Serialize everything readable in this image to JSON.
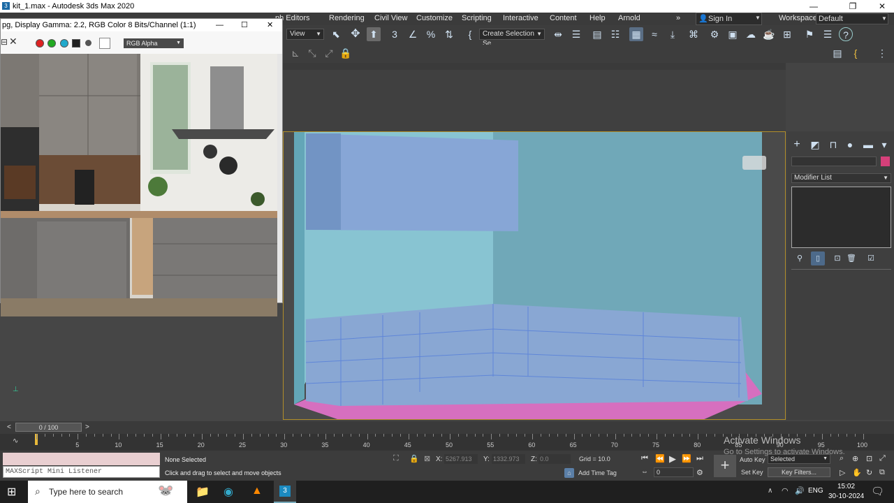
{
  "window": {
    "title": "kit_1.max - Autodesk 3ds Max 2020",
    "controls": {
      "minimize": "—",
      "maximize": "❐",
      "close": "✕"
    }
  },
  "menubar": {
    "items": [
      "ph Editors",
      "Rendering",
      "Civil View",
      "Customize",
      "Scripting",
      "Interactive",
      "Content",
      "Help",
      "Arnold"
    ],
    "more": "»",
    "sign_in": "Sign In",
    "workspaces_label": "Workspaces:",
    "workspace_value": "Default"
  },
  "toolbar": {
    "view_dropdown": "View",
    "selection_set": "Create Selection Se"
  },
  "image_window": {
    "title": "pg, Display Gamma: 2.2, RGB Color 8 Bits/Channel (1:1)",
    "channel_dropdown": "RGB Alpha"
  },
  "command_panel": {
    "modifier_list": "Modifier List",
    "swatch_color": "#d6407a"
  },
  "time_slider": {
    "label": "0 / 100",
    "prev": "<",
    "next": ">",
    "ticks": [
      "5",
      "10",
      "15",
      "20",
      "25",
      "30",
      "35",
      "40",
      "45",
      "50",
      "55",
      "60",
      "65",
      "70",
      "75",
      "80",
      "85",
      "90",
      "95",
      "100"
    ]
  },
  "status": {
    "maxscript": "MAXScript Mini Listener",
    "selection": "None Selected",
    "prompt": "Click and drag to select and move objects",
    "x_label": "X:",
    "x_value": "5267.913",
    "y_label": "Y:",
    "y_value": "1332.973",
    "z_label": "Z:",
    "z_value": "0.0",
    "grid": "Grid = 10.0",
    "add_time_tag": "Add Time Tag",
    "auto_key": "Auto Key",
    "set_key": "Set Key",
    "selected_dropdown": "Selected",
    "key_filters": "Key Filters...",
    "frame_value": "0"
  },
  "watermark": {
    "line1": "Activate Windows",
    "line2": "Go to Settings to activate Windows."
  },
  "taskbar": {
    "search_placeholder": "Type here to search",
    "lang": "ENG",
    "time": "15:02",
    "date": "30-10-2024"
  }
}
